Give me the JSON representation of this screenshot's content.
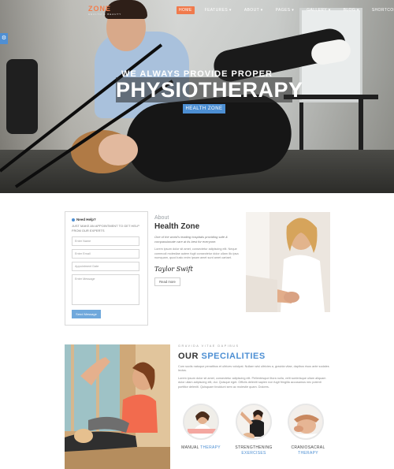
{
  "nav": {
    "logo_main": "ZONE",
    "logo_sub": "HEALTH & BEAUTY",
    "menu": [
      {
        "label": "HOME",
        "active": true
      },
      {
        "label": "FEATURES ▾",
        "active": false
      },
      {
        "label": "ABOUT ▾",
        "active": false
      },
      {
        "label": "PAGES ▾",
        "active": false
      },
      {
        "label": "GALLERY ▾",
        "active": false
      },
      {
        "label": "BLOG ▾",
        "active": false
      },
      {
        "label": "SHORTCODES ▾",
        "active": false
      }
    ]
  },
  "side_tab": {
    "icon": "sliders-icon",
    "glyph": "⚙"
  },
  "hero": {
    "pre_title": "WE ALWAYS PROVIDE PROPER",
    "title": "PHYSIOTHERAPY",
    "button": "HEALTH ZONE"
  },
  "form": {
    "help": "Need Help?",
    "note": "JUST MAKE AN APPOINTMENT TO GET HELP FROM OUR EXPERTS",
    "fields": {
      "name": "Enter Name",
      "email": "Enter Email",
      "date": "Appointment Date",
      "message": "Enter Message"
    },
    "send": "Send Message"
  },
  "about": {
    "label": "About",
    "title": "Health Zone",
    "italic": "One of the world's leading hospitals providing safe & compassionate care at its best for everyone.",
    "body": "Lorem ipsum dolor sit amet, consectetur adipiscing elit. Neque commodi molestiae autem fugit consectetur dolor ullam illo ipsa numquam, quod iusto enim ipsam amet sunt amet cartaet.",
    "signature": "Taylor Swift",
    "read_more": "Read more"
  },
  "specialities": {
    "kicker": "GRAVIDA VITAE DAPIBUS",
    "title_plain": "OUR ",
    "title_accent": "SPECIALITIES",
    "p1": "Cum sociis natoque penatibus et ultrices volutpat. Nullam wisi ultricies a, gravida vitae, dapibus risus ante sodales lectus.",
    "p2": "Lorem ipsum dolor sit amet, consectetur adipiscing elit. Pellentesque litora nulla, velit scelerisque ullam aliquam dolor ullam adipiscing elit, dui. Quisque eget. Officiis deleniti sapien non fugit fringilla accusamus nec potenti porttitor deleniti. Quisquam tincidunt sem ac molestie quam. Dolores.",
    "items": [
      {
        "plain": "MANUAL ",
        "accent": "THERAPY"
      },
      {
        "plain": "STRENGTHENING ",
        "accent": "EXERCISES"
      },
      {
        "plain": "CRANIOSACRAL ",
        "accent": "THERAPY"
      }
    ]
  },
  "colors": {
    "accent_orange": "#f07a4c",
    "accent_blue": "#4d8fd3"
  }
}
